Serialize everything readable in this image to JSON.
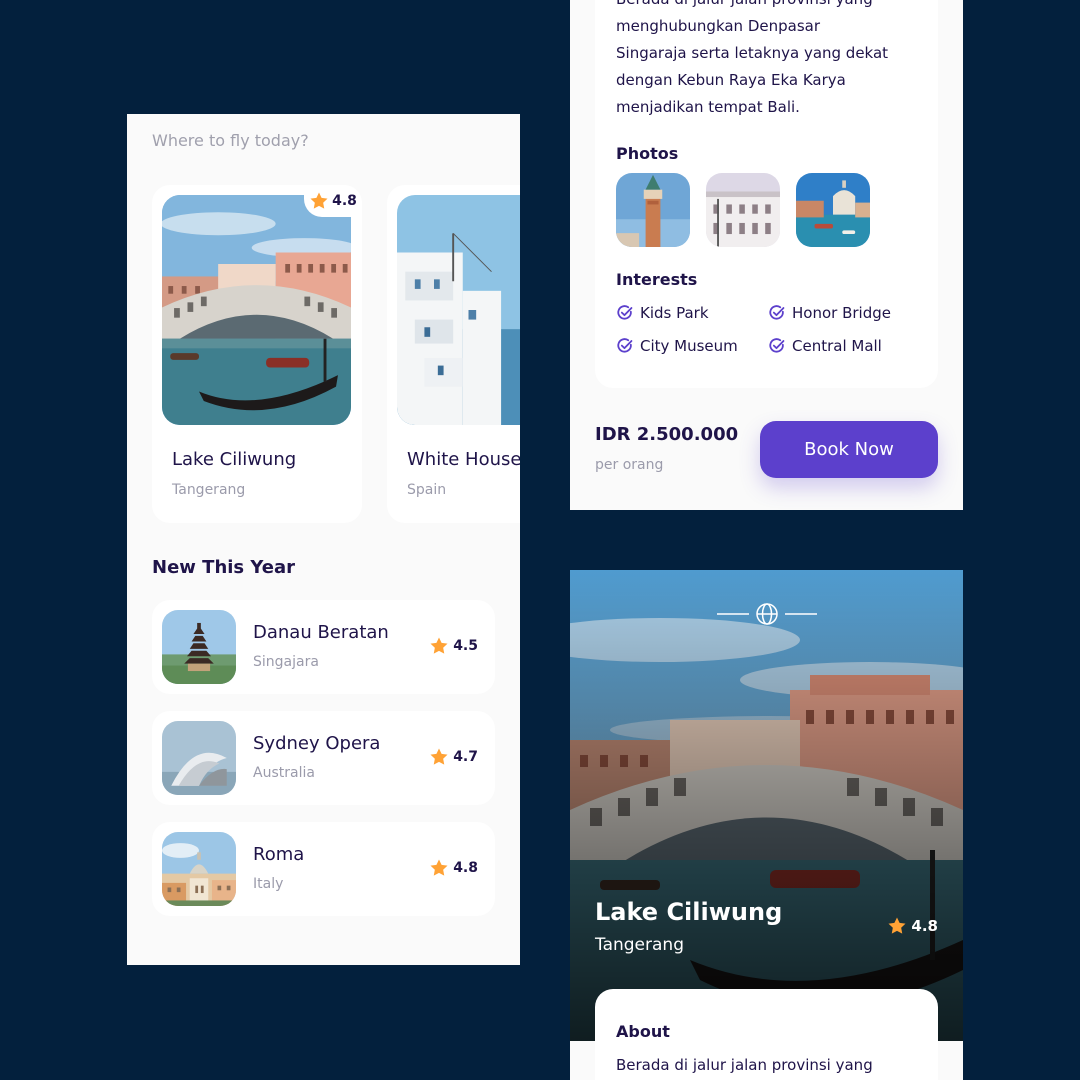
{
  "left_screen": {
    "search_hint": "Where to fly today?",
    "popular": [
      {
        "name": "Lake Ciliwung",
        "location": "Tangerang",
        "rating": "4.8"
      },
      {
        "name": "White House",
        "location": "Spain",
        "rating": ""
      }
    ],
    "new_section_title": "New This Year",
    "new_items": [
      {
        "name": "Danau Beratan",
        "location": "Singajara",
        "rating": "4.5"
      },
      {
        "name": "Sydney Opera",
        "location": "Australia",
        "rating": "4.7"
      },
      {
        "name": "Roma",
        "location": "Italy",
        "rating": "4.8"
      }
    ]
  },
  "detail_top": {
    "about_text_lines": [
      "Berada di jalur jalan provinsi yang",
      "menghubungkan Denpasar",
      "Singaraja serta letaknya yang dekat",
      "dengan Kebun Raya Eka Karya",
      "menjadikan tempat Bali."
    ],
    "photos_title": "Photos",
    "interests_title": "Interests",
    "interests": [
      "Kids Park",
      "Honor Bridge",
      "City Museum",
      "Central Mall"
    ],
    "price": "IDR 2.500.000",
    "price_unit": "per orang",
    "book_label": "Book Now"
  },
  "detail_hero": {
    "title": "Lake Ciliwung",
    "location": "Tangerang",
    "rating": "4.8",
    "about_title": "About",
    "about_first_line": "Berada di jalur jalan provinsi yang"
  },
  "icons": {
    "star": "star-icon",
    "check": "check-circle-icon",
    "globe": "globe-icon"
  },
  "colors": {
    "background": "#03203d",
    "primary": "#5c40cc",
    "star": "#ffa235",
    "text_dark": "#1f1449",
    "text_grey": "#9b9bab"
  }
}
